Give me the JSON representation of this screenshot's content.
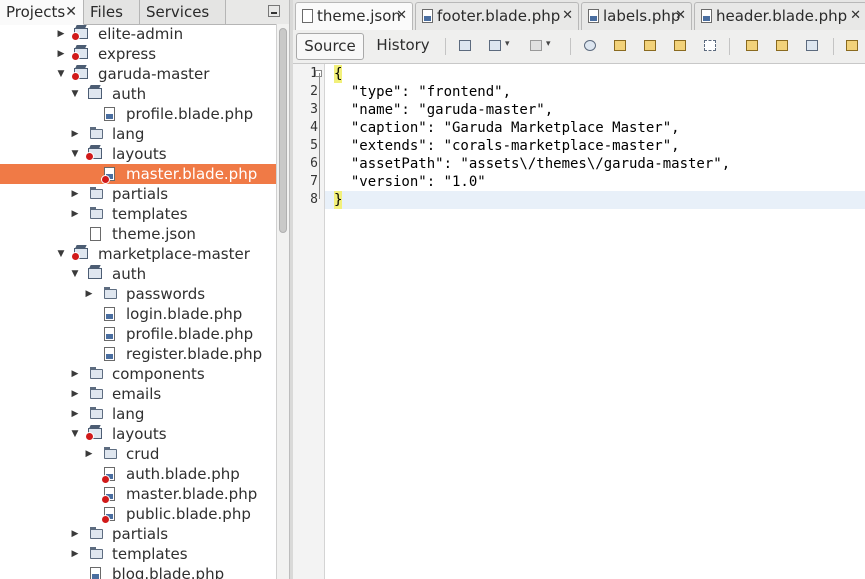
{
  "left_tabs": [
    {
      "label": "Projects",
      "active": true
    },
    {
      "label": "Files",
      "active": false
    },
    {
      "label": "Services",
      "active": false
    }
  ],
  "tree": {
    "rows": [
      {
        "label": "elite-admin",
        "toggle": "▶",
        "icon": "package-error-icon"
      },
      {
        "label": "express",
        "toggle": "▶",
        "icon": "package-error-icon"
      },
      {
        "label": "garuda-master",
        "toggle": "▼",
        "icon": "package-error-icon"
      },
      {
        "label": "auth",
        "toggle": "▼",
        "icon": "package-icon"
      },
      {
        "label": "profile.blade.php",
        "toggle": "",
        "icon": "php-file-icon"
      },
      {
        "label": "lang",
        "toggle": "▶",
        "icon": "folder-icon"
      },
      {
        "label": "layouts",
        "toggle": "▼",
        "icon": "package-error-icon"
      },
      {
        "label": "master.blade.php",
        "toggle": "",
        "icon": "php-file-error-icon",
        "selected": true
      },
      {
        "label": "partials",
        "toggle": "▶",
        "icon": "folder-icon"
      },
      {
        "label": "templates",
        "toggle": "▶",
        "icon": "folder-icon"
      },
      {
        "label": "theme.json",
        "toggle": "",
        "icon": "json-file-icon"
      },
      {
        "label": "marketplace-master",
        "toggle": "▼",
        "icon": "package-error-icon"
      },
      {
        "label": "auth",
        "toggle": "▼",
        "icon": "package-icon"
      },
      {
        "label": "passwords",
        "toggle": "▶",
        "icon": "folder-icon"
      },
      {
        "label": "login.blade.php",
        "toggle": "",
        "icon": "php-file-icon"
      },
      {
        "label": "profile.blade.php",
        "toggle": "",
        "icon": "php-file-icon"
      },
      {
        "label": "register.blade.php",
        "toggle": "",
        "icon": "php-file-icon"
      },
      {
        "label": "components",
        "toggle": "▶",
        "icon": "folder-icon"
      },
      {
        "label": "emails",
        "toggle": "▶",
        "icon": "folder-icon"
      },
      {
        "label": "lang",
        "toggle": "▶",
        "icon": "folder-icon"
      },
      {
        "label": "layouts",
        "toggle": "▼",
        "icon": "package-error-icon"
      },
      {
        "label": "crud",
        "toggle": "▶",
        "icon": "folder-icon"
      },
      {
        "label": "auth.blade.php",
        "toggle": "",
        "icon": "php-file-error-icon"
      },
      {
        "label": "master.blade.php",
        "toggle": "",
        "icon": "php-file-error-icon"
      },
      {
        "label": "public.blade.php",
        "toggle": "",
        "icon": "php-file-error-icon"
      },
      {
        "label": "partials",
        "toggle": "▶",
        "icon": "folder-icon"
      },
      {
        "label": "templates",
        "toggle": "▶",
        "icon": "folder-icon"
      },
      {
        "label": "blog.blade.php",
        "toggle": "",
        "icon": "php-file-icon"
      }
    ]
  },
  "file_tabs": [
    {
      "label": "theme.json",
      "active": true
    },
    {
      "label": "footer.blade.php",
      "active": false
    },
    {
      "label": "labels.php",
      "active": false
    },
    {
      "label": "header.blade.php",
      "active": false
    }
  ],
  "editor_toolbar": {
    "source_label": "Source",
    "history_label": "History"
  },
  "code": {
    "line_numbers": [
      "1",
      "2",
      "3",
      "4",
      "5",
      "6",
      "7",
      "8"
    ],
    "lines": [
      "{",
      "  \"type\": \"frontend\",",
      "  \"name\": \"garuda-master\",",
      "  \"caption\": \"Garuda Marketplace Master\",",
      "  \"extends\": \"corals-marketplace-master\",",
      "  \"assetPath\": \"assets\\/themes\\/garuda-master\",",
      "  \"version\": \"1.0\"",
      "}"
    ],
    "current_line": 8
  },
  "colors": {
    "selection": "#f07a46",
    "current_line": "#e8f0f9",
    "brace_match": "#f2f07a"
  }
}
